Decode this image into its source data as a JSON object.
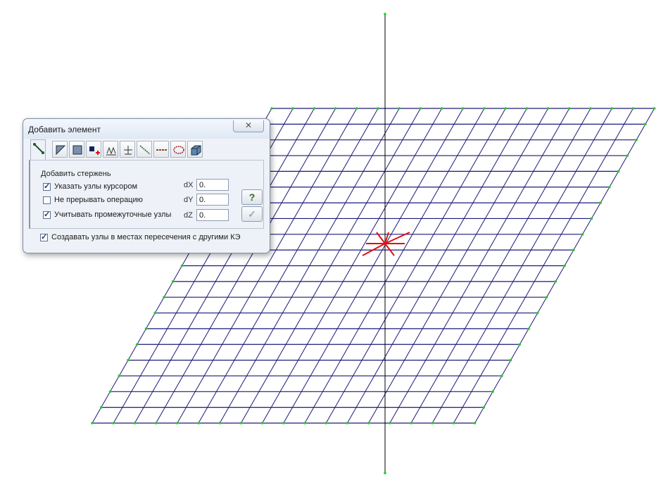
{
  "dialog": {
    "title": "Добавить элемент",
    "close_glyph": "✕",
    "tabs": [
      {
        "icon": "bar-element-icon",
        "active": true
      },
      {
        "icon": "triangle-element-icon"
      },
      {
        "icon": "quad-element-icon"
      },
      {
        "icon": "node-add-icon"
      },
      {
        "icon": "spring-element-icon"
      },
      {
        "icon": "rigid-link-icon"
      },
      {
        "icon": "diagonal-bar-icon"
      },
      {
        "icon": "chain-element-icon"
      },
      {
        "icon": "ellipse-element-icon"
      },
      {
        "icon": "solid-element-icon"
      }
    ],
    "group_title": "Добавить стержень",
    "options": [
      {
        "label": "Указать узлы курсором",
        "checked": true
      },
      {
        "label": "Не прерывать операцию",
        "checked": false
      },
      {
        "label": "Учитывать промежуточные узлы",
        "checked": true
      }
    ],
    "offsets": {
      "dx_label": "dX",
      "dx_value": "0.",
      "dy_label": "dY",
      "dy_value": "0.",
      "dz_label": "dZ",
      "dz_value": "0."
    },
    "help_label": "?",
    "apply_label": "✓",
    "intersection_option": {
      "label": "Создавать узлы в местах пересечения с другими КЭ",
      "checked": true
    }
  },
  "colors": {
    "mesh_line": "#1a1a7a",
    "node": "#22cc22",
    "axis": "#000000",
    "selection": "#e01010"
  }
}
